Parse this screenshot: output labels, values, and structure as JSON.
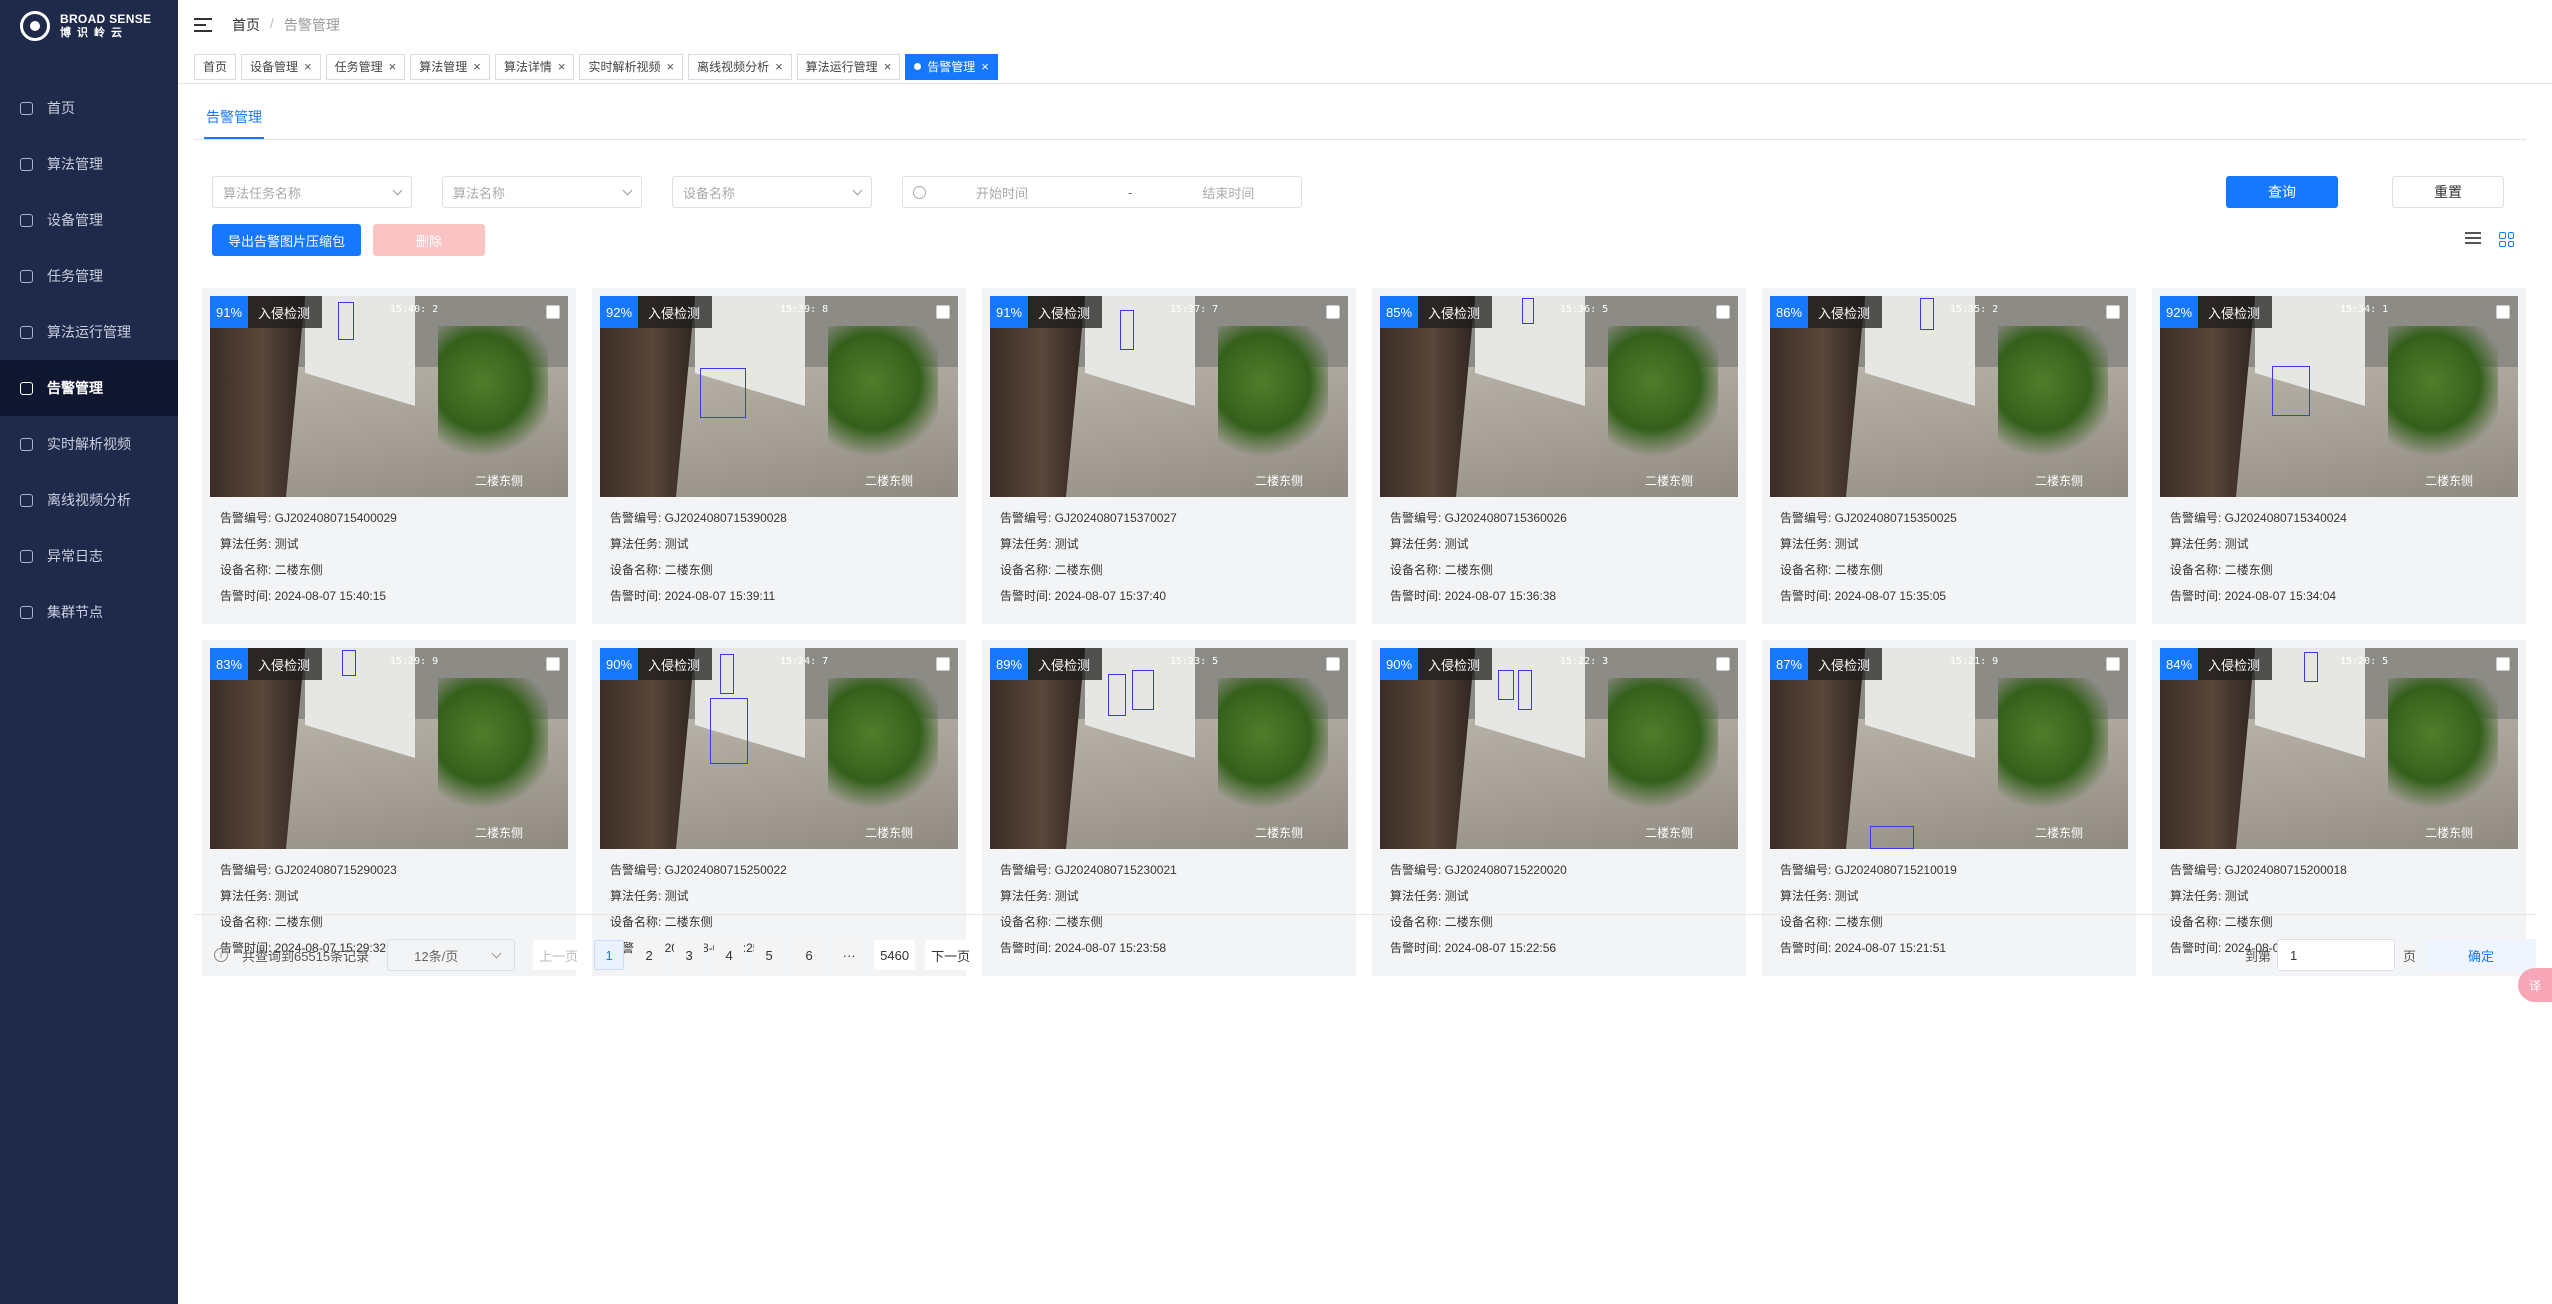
{
  "brand": {
    "en": "BROAD SENSE",
    "cn": "博识岭云"
  },
  "sidebar": {
    "items": [
      {
        "label": "首页",
        "icon": "home-icon",
        "active": false
      },
      {
        "label": "算法管理",
        "icon": "algorithm-icon",
        "active": false
      },
      {
        "label": "设备管理",
        "icon": "device-icon",
        "active": false
      },
      {
        "label": "任务管理",
        "icon": "task-icon",
        "active": false
      },
      {
        "label": "算法运行管理",
        "icon": "run-icon",
        "active": false
      },
      {
        "label": "告警管理",
        "icon": "alarm-icon",
        "active": true
      },
      {
        "label": "实时解析视频",
        "icon": "video-icon",
        "active": false
      },
      {
        "label": "离线视频分析",
        "icon": "offline-icon",
        "active": false
      },
      {
        "label": "异常日志",
        "icon": "log-icon",
        "active": false
      },
      {
        "label": "集群节点",
        "icon": "cluster-icon",
        "active": false
      }
    ]
  },
  "breadcrumb": {
    "home": "首页",
    "sep": "/",
    "current": "告警管理"
  },
  "tabs": [
    {
      "label": "首页",
      "closable": false,
      "active": false
    },
    {
      "label": "设备管理",
      "closable": true,
      "active": false
    },
    {
      "label": "任务管理",
      "closable": true,
      "active": false
    },
    {
      "label": "算法管理",
      "closable": true,
      "active": false
    },
    {
      "label": "算法详情",
      "closable": true,
      "active": false
    },
    {
      "label": "实时解析视频",
      "closable": true,
      "active": false
    },
    {
      "label": "离线视频分析",
      "closable": true,
      "active": false
    },
    {
      "label": "算法运行管理",
      "closable": true,
      "active": false
    },
    {
      "label": "告警管理",
      "closable": true,
      "active": true
    }
  ],
  "subtab": "告警管理",
  "filters": {
    "task_placeholder": "算法任务名称",
    "algo_placeholder": "算法名称",
    "device_placeholder": "设备名称",
    "start_placeholder": "开始时间",
    "range_sep": "-",
    "end_placeholder": "结束时间",
    "query_label": "查询",
    "reset_label": "重置"
  },
  "actions": {
    "export_label": "导出告警图片压缩包",
    "delete_label": "删除"
  },
  "labels": {
    "id": "告警编号: ",
    "task": "算法任务: ",
    "device": "设备名称: ",
    "time": "告警时间: "
  },
  "cards": [
    {
      "pct": "91%",
      "type": "入侵检测",
      "ts": "15:40: 2",
      "loc": "二楼东侧",
      "id": "GJ2024080715400029",
      "task": "测试",
      "device": "二楼东侧",
      "time": "2024-08-07 15:40:15"
    },
    {
      "pct": "92%",
      "type": "入侵检测",
      "ts": "15:39: 8",
      "loc": "二楼东侧",
      "id": "GJ2024080715390028",
      "task": "测试",
      "device": "二楼东侧",
      "time": "2024-08-07 15:39:11"
    },
    {
      "pct": "91%",
      "type": "入侵检测",
      "ts": "15:37: 7",
      "loc": "二楼东侧",
      "id": "GJ2024080715370027",
      "task": "测试",
      "device": "二楼东侧",
      "time": "2024-08-07 15:37:40"
    },
    {
      "pct": "85%",
      "type": "入侵检测",
      "ts": "15:36: 5",
      "loc": "二楼东侧",
      "id": "GJ2024080715360026",
      "task": "测试",
      "device": "二楼东侧",
      "time": "2024-08-07 15:36:38"
    },
    {
      "pct": "86%",
      "type": "入侵检测",
      "ts": "15:35: 2",
      "loc": "二楼东侧",
      "id": "GJ2024080715350025",
      "task": "测试",
      "device": "二楼东侧",
      "time": "2024-08-07 15:35:05"
    },
    {
      "pct": "92%",
      "type": "入侵检测",
      "ts": "15:34: 1",
      "loc": "二楼东侧",
      "id": "GJ2024080715340024",
      "task": "测试",
      "device": "二楼东侧",
      "time": "2024-08-07 15:34:04"
    },
    {
      "pct": "83%",
      "type": "入侵检测",
      "ts": "15:29: 9",
      "loc": "二楼东侧",
      "id": "GJ2024080715290023",
      "task": "测试",
      "device": "二楼东侧",
      "time": "2024-08-07 15:29:32"
    },
    {
      "pct": "90%",
      "type": "入侵检测",
      "ts": "15:24: 7",
      "loc": "二楼东侧",
      "id": "GJ2024080715250022",
      "task": "测试",
      "device": "二楼东侧",
      "time": "2024-08-07 15:25:00"
    },
    {
      "pct": "89%",
      "type": "入侵检测",
      "ts": "15:23: 5",
      "loc": "二楼东侧",
      "id": "GJ2024080715230021",
      "task": "测试",
      "device": "二楼东侧",
      "time": "2024-08-07 15:23:58"
    },
    {
      "pct": "90%",
      "type": "入侵检测",
      "ts": "15:22: 3",
      "loc": "二楼东侧",
      "id": "GJ2024080715220020",
      "task": "测试",
      "device": "二楼东侧",
      "time": "2024-08-07 15:22:56"
    },
    {
      "pct": "87%",
      "type": "入侵检测",
      "ts": "15:21: 9",
      "loc": "二楼东侧",
      "id": "GJ2024080715210019",
      "task": "测试",
      "device": "二楼东侧",
      "time": "2024-08-07 15:21:51"
    },
    {
      "pct": "84%",
      "type": "入侵检测",
      "ts": "15:20: 5",
      "loc": "二楼东侧",
      "id": "GJ2024080715200018",
      "task": "测试",
      "device": "二楼东侧",
      "time": "2024-08-07 15:20:48"
    }
  ],
  "pagination": {
    "total_text": "共查询到65515条记录",
    "page_size": "12条/页",
    "prev": "上一页",
    "pages": [
      "1",
      "2",
      "3",
      "4",
      "5",
      "6"
    ],
    "ellipsis": "···",
    "last": "5460",
    "next": "下一页",
    "goto_prefix": "到第",
    "goto_value": "1",
    "goto_suffix": "页",
    "confirm": "确定"
  },
  "float_button": "译",
  "colors": {
    "primary": "#1677ff",
    "sidebar": "#1f2a4a",
    "danger_light": "#fbc4c4"
  }
}
